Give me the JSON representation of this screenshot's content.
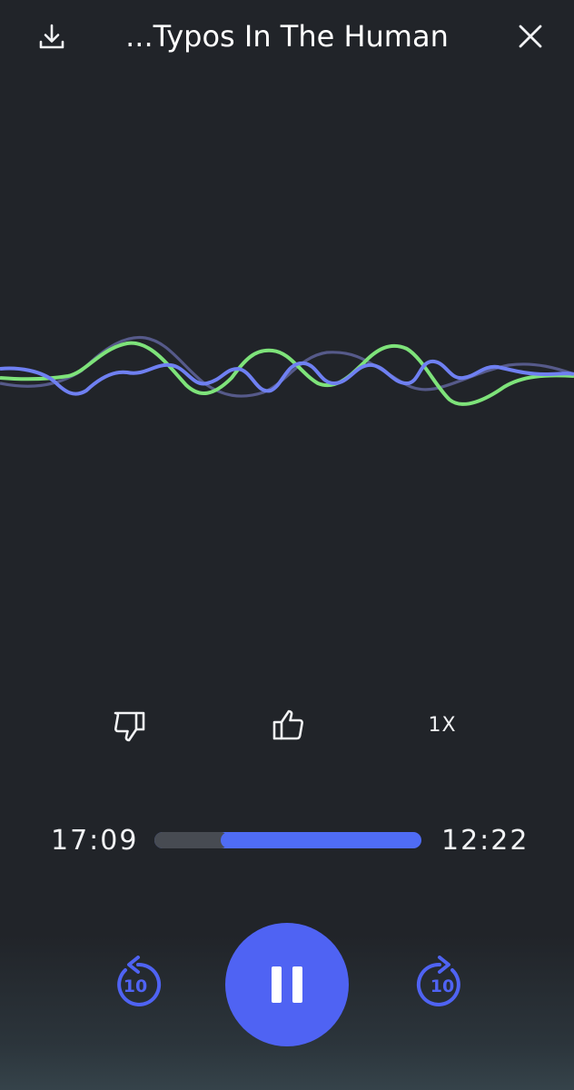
{
  "header": {
    "title": "...Typos In The Human"
  },
  "icons": {
    "download": "download-icon",
    "close": "close-icon",
    "dislike": "thumbs-down-icon",
    "like": "thumbs-up-icon",
    "rewind": "rewind-10-icon",
    "forward": "forward-10-icon",
    "pause": "pause-icon"
  },
  "actions": {
    "speed_label": "1X"
  },
  "player": {
    "elapsed": "17:09",
    "remaining": "12:22",
    "progress_fraction": 0.28,
    "skip_back_label": "10",
    "skip_forward_label": "10"
  },
  "colors": {
    "background": "#212429",
    "accent": "#4f63f3",
    "wave_green": "#7ee37a",
    "wave_blue": "#6f80f2",
    "wave_faint": "#565a8a",
    "track_played": "#474b52"
  }
}
